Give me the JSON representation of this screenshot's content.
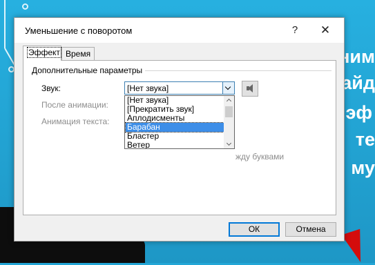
{
  "background": {
    "slide_text_fragments": [
      "ним",
      "айд",
      "эф",
      "те",
      "му"
    ]
  },
  "dialog": {
    "title": "Уменьшение с поворотом",
    "help_symbol": "?",
    "close_symbol": "✕",
    "tabs": [
      {
        "label": "Эффект",
        "active": true
      },
      {
        "label": "Время",
        "active": false
      }
    ],
    "group_title": "Дополнительные параметры",
    "sound": {
      "label": "Звук:",
      "selected_value": "[Нет звука]",
      "options": [
        "[Нет звука]",
        "[Прекратить звук]",
        "Аплодисменты",
        "Барабан",
        "Бластер",
        "Ветер"
      ],
      "highlighted_option": "Барабан"
    },
    "after_animation_label": "После анимации:",
    "animate_text_label": "Анимация текста:",
    "between_letters_partial": "жду буквами",
    "ok_label": "ОК",
    "cancel_label": "Отмена"
  },
  "colors": {
    "slide_background": "#23a6d6",
    "selection": "#3d8ee8",
    "focus_border": "#0078d7",
    "arrow_red": "#d40c0c"
  }
}
